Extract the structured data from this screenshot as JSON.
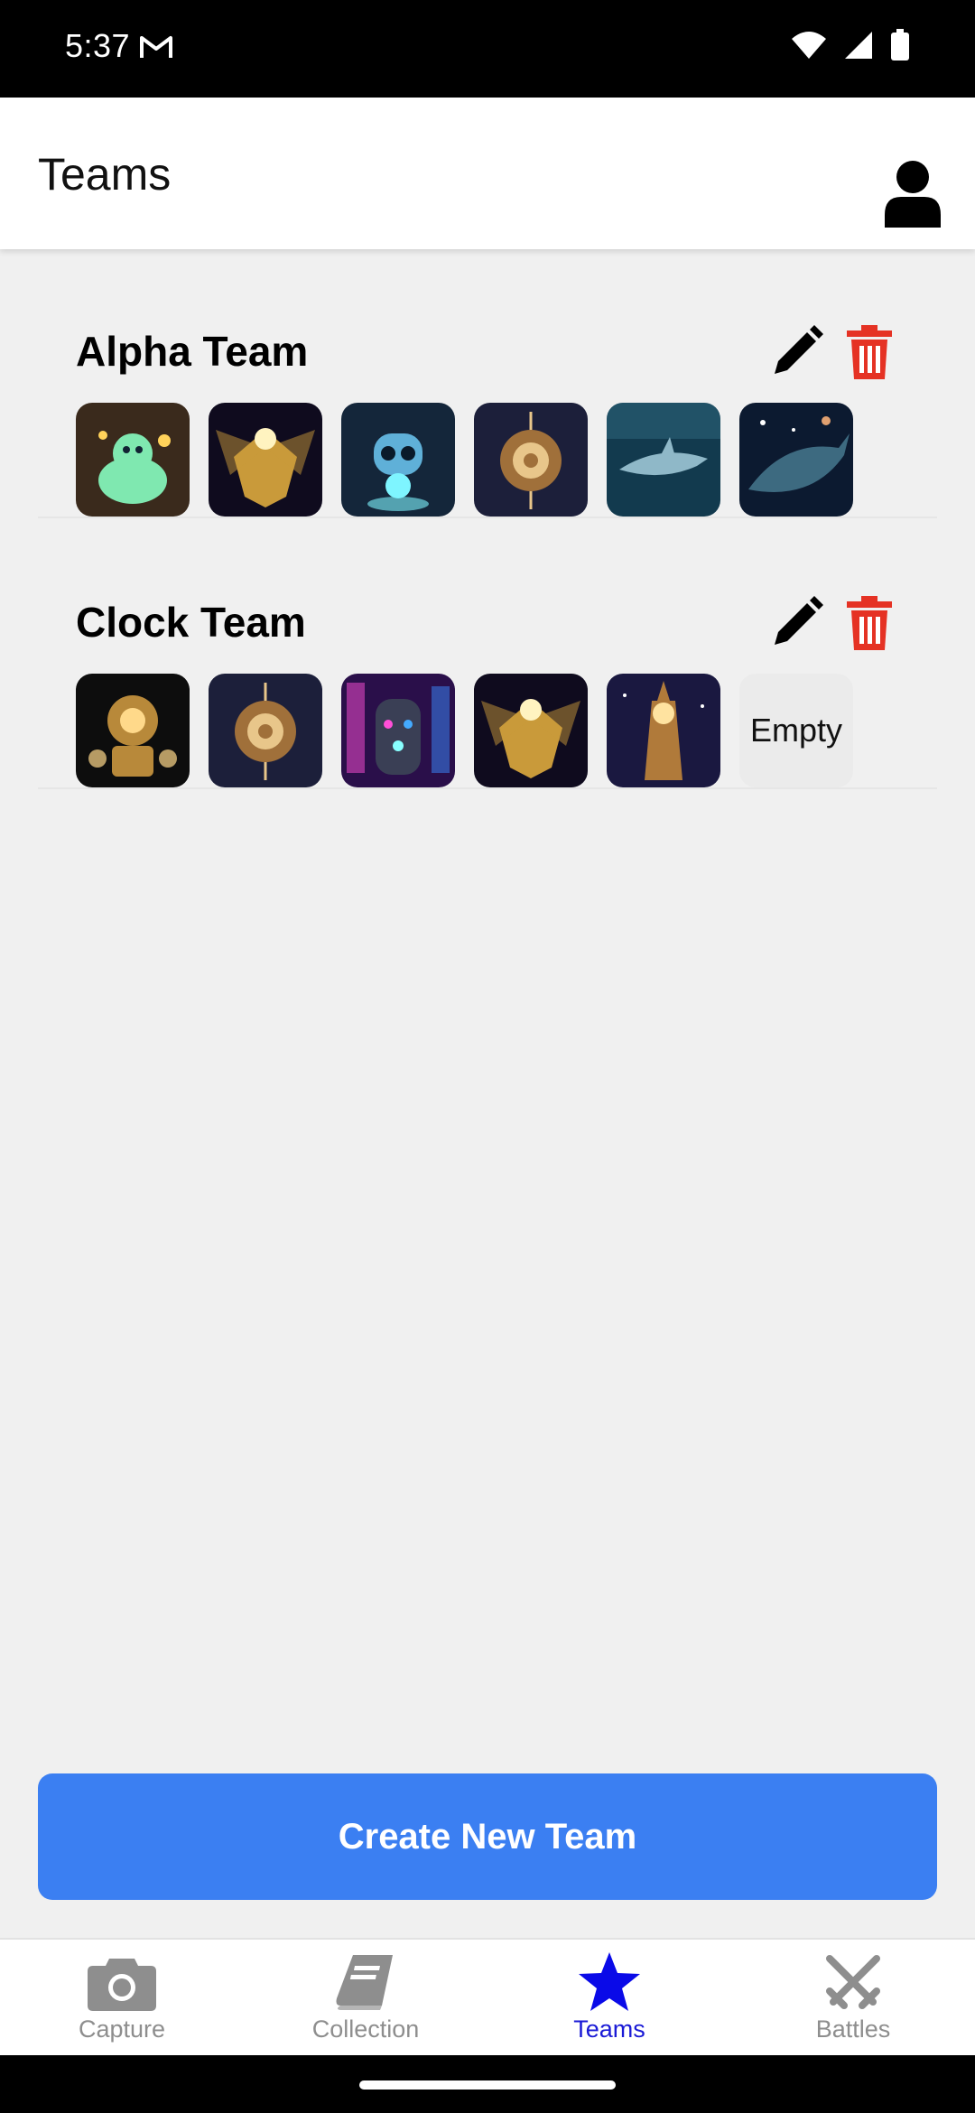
{
  "status_bar": {
    "time": "5:37",
    "icons": [
      "gmail-icon",
      "wifi-icon",
      "signal-icon",
      "battery-icon"
    ]
  },
  "header": {
    "title": "Teams",
    "profile_icon": "person-icon"
  },
  "teams": [
    {
      "name": "Alpha Team",
      "members": [
        {
          "theme": "slime-creature",
          "bg": "#3a2a1c",
          "fg": "#7fe8b0",
          "accent": "#ffd25a"
        },
        {
          "theme": "golden-winged-idol",
          "bg": "#0f0b1e",
          "fg": "#c99a3a",
          "accent": "#fff3c0"
        },
        {
          "theme": "robot-owl",
          "bg": "#14263a",
          "fg": "#5fb0d8",
          "accent": "#7ef5ff"
        },
        {
          "theme": "clockwork-orb",
          "bg": "#1c1f3a",
          "fg": "#a0703a",
          "accent": "#e8c68a"
        },
        {
          "theme": "shark",
          "bg": "#123a4e",
          "fg": "#8fb8c8",
          "accent": "#2f6a80"
        },
        {
          "theme": "space-whale",
          "bg": "#0c1a30",
          "fg": "#3d6a80",
          "accent": "#e0a070"
        }
      ]
    },
    {
      "name": "Clock Team",
      "members": [
        {
          "theme": "clockwork-golem",
          "bg": "#0d0d0d",
          "fg": "#b8893a",
          "accent": "#ffd98a"
        },
        {
          "theme": "clockwork-orb",
          "bg": "#1c1f3a",
          "fg": "#a0703a",
          "accent": "#e8c68a"
        },
        {
          "theme": "neon-remote",
          "bg": "#2a0f4a",
          "fg": "#3a3f55",
          "accent": "#ff4fd8"
        },
        {
          "theme": "golden-winged-idol",
          "bg": "#0f0b1e",
          "fg": "#c99a3a",
          "accent": "#fff3c0"
        },
        {
          "theme": "clock-tower",
          "bg": "#1a1840",
          "fg": "#b07a3a",
          "accent": "#ffe3a0"
        }
      ],
      "empty_label": "Empty"
    }
  ],
  "actions": {
    "edit_icon": "pencil-icon",
    "delete_icon": "trash-icon",
    "delete_color": "#e53224"
  },
  "create_button": {
    "label": "Create New Team",
    "color": "#3b7ff2"
  },
  "bottom_nav": {
    "items": [
      {
        "label": "Capture",
        "icon": "camera-icon",
        "active": false
      },
      {
        "label": "Collection",
        "icon": "book-icon",
        "active": false
      },
      {
        "label": "Teams",
        "icon": "star-icon",
        "active": true
      },
      {
        "label": "Battles",
        "icon": "crossed-swords-icon",
        "active": false
      }
    ],
    "active_color": "#1a1ad6",
    "inactive_color": "#8e8e8e"
  }
}
